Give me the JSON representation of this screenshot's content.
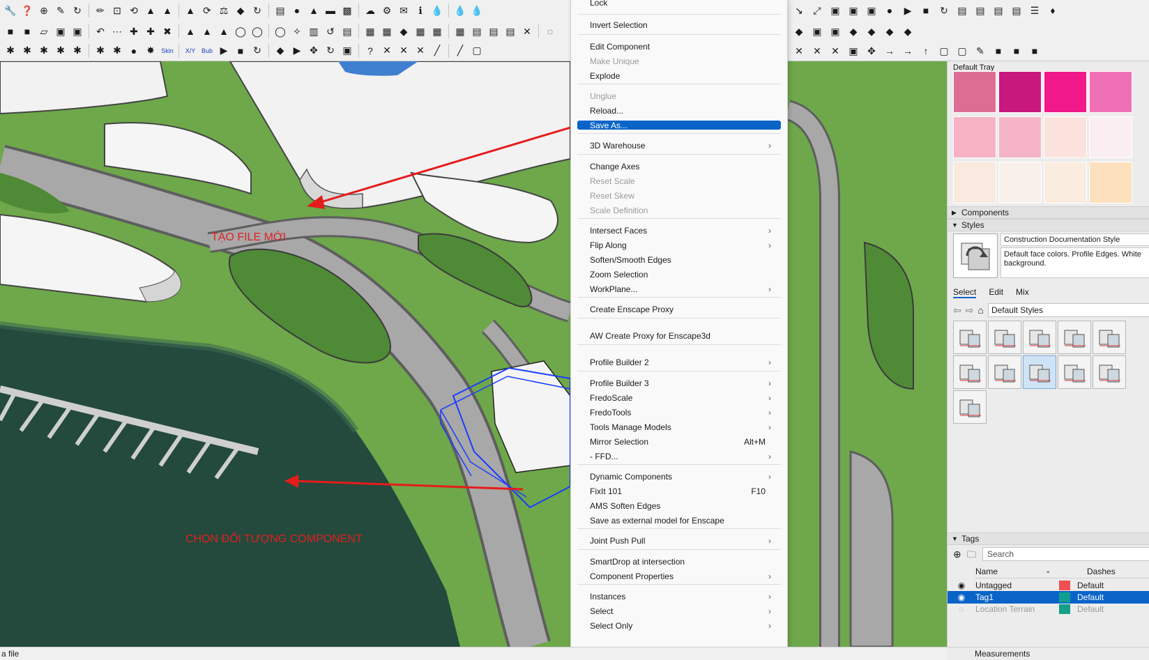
{
  "toolbars": {
    "row1": [
      "🔧",
      "❓",
      "⊕",
      "✎",
      "↻",
      "✏",
      "⊡",
      "⟲",
      "▲",
      "▲",
      "▲",
      "⟳",
      "⚖",
      "◆",
      "↻",
      "▤",
      "●",
      "▲",
      "▬",
      "▩",
      "☁",
      "⚙",
      "✉",
      "ℹ",
      "💧",
      "💧",
      "💧"
    ],
    "row2": [
      "■",
      "■",
      "▱",
      "▣",
      "▣",
      "↶",
      "⋯",
      "✚",
      "✚",
      "✖",
      "▲",
      "▲",
      "▲",
      "◯",
      "◯",
      "◯",
      "✧",
      "▥",
      "↺",
      "▤",
      "▦",
      "▦",
      "◆",
      "▦",
      "▦",
      "▦",
      "▤",
      "▤",
      "▤",
      "✕",
      "◌"
    ],
    "row3": [
      "✱",
      "✱",
      "✱",
      "✱",
      "✱",
      "✱",
      "✱",
      "●",
      "✸",
      "Skin",
      "X/Y",
      "Bub",
      "▶",
      "■",
      "↻",
      "◆",
      "▶",
      "✥",
      "↻",
      "▣",
      "?",
      "✕",
      "✕",
      "✕",
      "╱",
      "╱",
      "▢"
    ],
    "right_row1": [
      "↘",
      "⤢",
      "▣",
      "▣",
      "▣",
      "●",
      "▶",
      "■",
      "↻",
      "▤",
      "▤",
      "▤",
      "▤",
      "☰",
      "♦"
    ],
    "right_row2": [
      "◆",
      "▣",
      "▣",
      "◆",
      "◆",
      "◆",
      "◆"
    ],
    "right_row3": [
      "✕",
      "✕",
      "✕",
      "▣",
      "✥",
      "→",
      "→",
      "↑",
      "▢",
      "▢",
      "✎",
      "■",
      "■",
      "■"
    ]
  },
  "viewport": {
    "annotation_new_file": "TẠO FILE MỚI",
    "annotation_select_component": "CHỌN ĐỐI TƯỢNG COMPONENT"
  },
  "context_menu": {
    "items": [
      {
        "label": "Lock",
        "state": "normal",
        "submenu": false,
        "shortcut": ""
      },
      {
        "label": "Invert Selection",
        "state": "normal",
        "submenu": false,
        "shortcut": ""
      },
      {
        "label": "Edit Component",
        "state": "normal",
        "submenu": false,
        "shortcut": ""
      },
      {
        "label": "Make Unique",
        "state": "disabled",
        "submenu": false,
        "shortcut": ""
      },
      {
        "label": "Explode",
        "state": "normal",
        "submenu": false,
        "shortcut": ""
      },
      {
        "label": "Unglue",
        "state": "disabled",
        "submenu": false,
        "shortcut": ""
      },
      {
        "label": "Reload...",
        "state": "normal",
        "submenu": false,
        "shortcut": ""
      },
      {
        "label": "Save As...",
        "state": "highlighted",
        "submenu": false,
        "shortcut": ""
      },
      {
        "label": "3D Warehouse",
        "state": "normal",
        "submenu": true,
        "shortcut": ""
      },
      {
        "label": "Change Axes",
        "state": "normal",
        "submenu": false,
        "shortcut": ""
      },
      {
        "label": "Reset Scale",
        "state": "disabled",
        "submenu": false,
        "shortcut": ""
      },
      {
        "label": "Reset Skew",
        "state": "disabled",
        "submenu": false,
        "shortcut": ""
      },
      {
        "label": "Scale Definition",
        "state": "disabled",
        "submenu": false,
        "shortcut": ""
      },
      {
        "label": "Intersect Faces",
        "state": "normal",
        "submenu": true,
        "shortcut": ""
      },
      {
        "label": "Flip Along",
        "state": "normal",
        "submenu": true,
        "shortcut": ""
      },
      {
        "label": "Soften/Smooth Edges",
        "state": "normal",
        "submenu": false,
        "shortcut": ""
      },
      {
        "label": "Zoom Selection",
        "state": "normal",
        "submenu": false,
        "shortcut": ""
      },
      {
        "label": "WorkPlane...",
        "state": "normal",
        "submenu": true,
        "shortcut": ""
      },
      {
        "label": "Create Enscape Proxy",
        "state": "normal",
        "submenu": false,
        "shortcut": ""
      },
      {
        "label": "AW Create Proxy for Enscape3d",
        "state": "normal",
        "submenu": false,
        "shortcut": ""
      },
      {
        "label": "Profile Builder 2",
        "state": "normal",
        "submenu": true,
        "shortcut": ""
      },
      {
        "label": "Profile Builder 3",
        "state": "normal",
        "submenu": true,
        "shortcut": ""
      },
      {
        "label": "FredoScale",
        "state": "normal",
        "submenu": true,
        "shortcut": ""
      },
      {
        "label": "FredoTools",
        "state": "normal",
        "submenu": true,
        "shortcut": ""
      },
      {
        "label": "Tools Manage Models",
        "state": "normal",
        "submenu": true,
        "shortcut": ""
      },
      {
        "label": "Mirror Selection",
        "state": "normal",
        "submenu": false,
        "shortcut": "Alt+M"
      },
      {
        "label": "- FFD...",
        "state": "normal",
        "submenu": true,
        "shortcut": ""
      },
      {
        "label": "Dynamic Components",
        "state": "normal",
        "submenu": true,
        "shortcut": ""
      },
      {
        "label": "FixIt 101",
        "state": "normal",
        "submenu": false,
        "shortcut": "F10"
      },
      {
        "label": "AMS Soften Edges",
        "state": "normal",
        "submenu": false,
        "shortcut": ""
      },
      {
        "label": "Save as external model for Enscape",
        "state": "normal",
        "submenu": false,
        "shortcut": ""
      },
      {
        "label": "Joint Push Pull",
        "state": "normal",
        "submenu": true,
        "shortcut": ""
      },
      {
        "label": "SmartDrop at intersection",
        "state": "normal",
        "submenu": false,
        "shortcut": ""
      },
      {
        "label": "Component Properties",
        "state": "normal",
        "submenu": true,
        "shortcut": ""
      },
      {
        "label": "Instances",
        "state": "normal",
        "submenu": true,
        "shortcut": ""
      },
      {
        "label": "Select",
        "state": "normal",
        "submenu": true,
        "shortcut": ""
      },
      {
        "label": "Select Only",
        "state": "normal",
        "submenu": true,
        "shortcut": ""
      }
    ]
  },
  "tray": {
    "title": "Default Tray",
    "swatches": [
      "#dc6e94",
      "#c8187e",
      "#f0188a",
      "#f070b8",
      "#f7b2c4",
      "#f5b4c6",
      "#fbe2dc",
      "#fbeef3",
      "#f9e9df",
      "#f9f0ea",
      "#fbece0",
      "#fde0bd",
      "#ec7a70",
      "#f0906c",
      "#f07850",
      "#f06040"
    ],
    "components_label": "Components",
    "styles_label": "Styles",
    "style_name": "Construction Documentation Style",
    "style_description": "Default face colors. Profile Edges. White background.",
    "tabs": [
      "Select",
      "Edit",
      "Mix"
    ],
    "style_collection": "Default Styles",
    "tags_label": "Tags",
    "tags_search_placeholder": "Search",
    "tags_columns": {
      "name": "Name",
      "dashes": "Dashes"
    },
    "tags": [
      {
        "name": "Untagged",
        "color": "#f05050",
        "dashes": "Default",
        "state": "normal"
      },
      {
        "name": "Tag1",
        "color": "#10a090",
        "dashes": "Default",
        "state": "selected"
      },
      {
        "name": "Location Terrain",
        "color": "#14a088",
        "dashes": "Default",
        "state": "dim"
      }
    ],
    "measurements_label": "Measurements"
  },
  "statusbar": {
    "text": "a file"
  },
  "colors": {
    "accent": "#0a64c8",
    "annotation": "#e02020",
    "grass": "#6ea84a"
  }
}
